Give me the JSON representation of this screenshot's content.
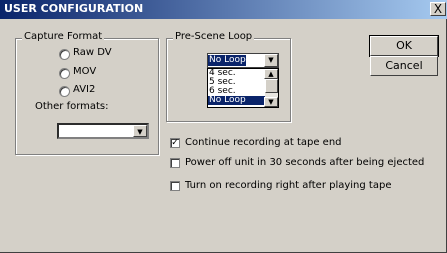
{
  "window": {
    "title": "USER CONFIGURATION",
    "close_label": "X"
  },
  "capture_format": {
    "legend": "Capture Format",
    "options": [
      {
        "label": "Raw DV"
      },
      {
        "label": "MOV"
      },
      {
        "label": "AVI2"
      }
    ],
    "other_formats_label": "Other formats:",
    "other_formats_value": ""
  },
  "pre_scene_loop": {
    "legend": "Pre-Scene Loop",
    "selected": "No Loop",
    "options": [
      "4 sec.",
      "5 sec.",
      "6 sec.",
      "No Loop"
    ]
  },
  "buttons": {
    "ok": "OK",
    "cancel": "Cancel"
  },
  "options": {
    "continue_recording": {
      "label": "Continue recording at tape end",
      "checked": true
    },
    "power_off": {
      "label": "Power off unit in 30 seconds after being ejected",
      "checked": false
    },
    "turn_on": {
      "label": "Turn on recording right after playing tape",
      "checked": false
    }
  },
  "icons": {
    "dropdown_arrow": "▼",
    "scroll_up": "▲",
    "scroll_down": "▼",
    "check": "✓"
  }
}
